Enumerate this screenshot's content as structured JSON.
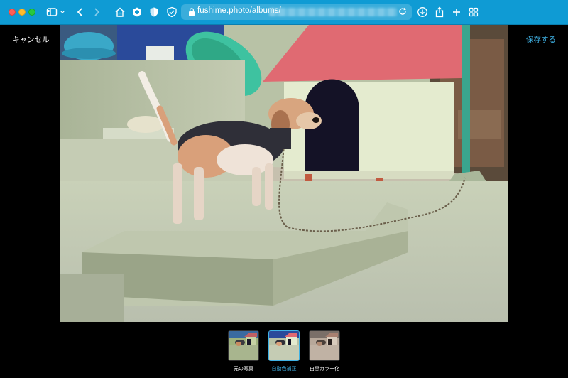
{
  "browser": {
    "toolbar_color": "#0f9bd4",
    "url_visible": "fushime.photo/albums/",
    "icons": [
      "sidebar-icon",
      "chevron-down-icon",
      "back-icon",
      "forward-icon",
      "home-icon",
      "hexagon-extension-icon",
      "shield-extension-icon",
      "check-shield-icon",
      "lock-icon",
      "reload-icon",
      "download-icon",
      "share-icon",
      "new-tab-icon",
      "tab-overview-icon"
    ]
  },
  "editor": {
    "cancel_label": "キャンセル",
    "save_label": "保存する",
    "accent_color": "#3fb1e4",
    "filters": [
      {
        "label": "元の写真",
        "active": false
      },
      {
        "label": "自動色補正",
        "active": true
      },
      {
        "label": "白黒カラー化",
        "active": false
      }
    ]
  }
}
